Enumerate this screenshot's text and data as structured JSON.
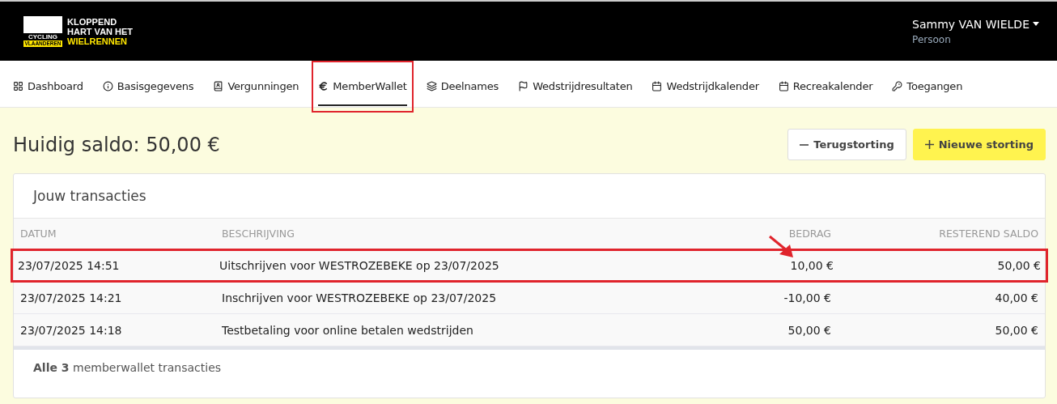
{
  "logo": {
    "badge_top": "CYCLING",
    "badge_bottom": "VLAANDEREN",
    "lines": [
      "KLOPPEND",
      "HART VAN HET"
    ],
    "highlight_line": "WIELRENNEN"
  },
  "user": {
    "name": "Sammy VAN WIELDE",
    "role": "Persoon"
  },
  "tabs": [
    {
      "label": "Dashboard",
      "selected": false,
      "annotated": false
    },
    {
      "label": "Basisgegevens",
      "selected": false,
      "annotated": false
    },
    {
      "label": "Vergunningen",
      "selected": false,
      "annotated": false
    },
    {
      "label": "MemberWallet",
      "selected": true,
      "annotated": true
    },
    {
      "label": "Deelnames",
      "selected": false,
      "annotated": false
    },
    {
      "label": "Wedstrijdresultaten",
      "selected": false,
      "annotated": false
    },
    {
      "label": "Wedstrijdkalender",
      "selected": false,
      "annotated": false
    },
    {
      "label": "Recreakalender",
      "selected": false,
      "annotated": false
    },
    {
      "label": "Toegangen",
      "selected": false,
      "annotated": false
    }
  ],
  "balance_title": "Huidig saldo: 50,00 €",
  "buttons": [
    {
      "label": "Terugstorting",
      "kind": "minus"
    },
    {
      "label": "Nieuwe storting",
      "kind": "plus"
    }
  ],
  "card": {
    "title": "Jouw transacties",
    "table": {
      "columns": [
        "DATUM",
        "BESCHRIJVING",
        "BEDRAG",
        "RESTEREND SALDO"
      ],
      "rows": [
        {
          "cells": [
            "23/07/2025 14:51",
            "Uitschrijven voor WESTROZEBEKE op 23/07/2025",
            "10,00 €",
            "50,00 €"
          ],
          "annotated": true
        },
        {
          "cells": [
            "23/07/2025 14:21",
            "Inschrijven voor WESTROZEBEKE op 23/07/2025",
            "-10,00 €",
            "40,00 €"
          ],
          "annotated": false
        },
        {
          "cells": [
            "23/07/2025 14:18",
            "Testbetaling voor online betalen wedstrijden",
            "50,00 €",
            "50,00 €"
          ],
          "annotated": false
        }
      ]
    },
    "footer": "**Alle 3** memberwallet transacties"
  }
}
